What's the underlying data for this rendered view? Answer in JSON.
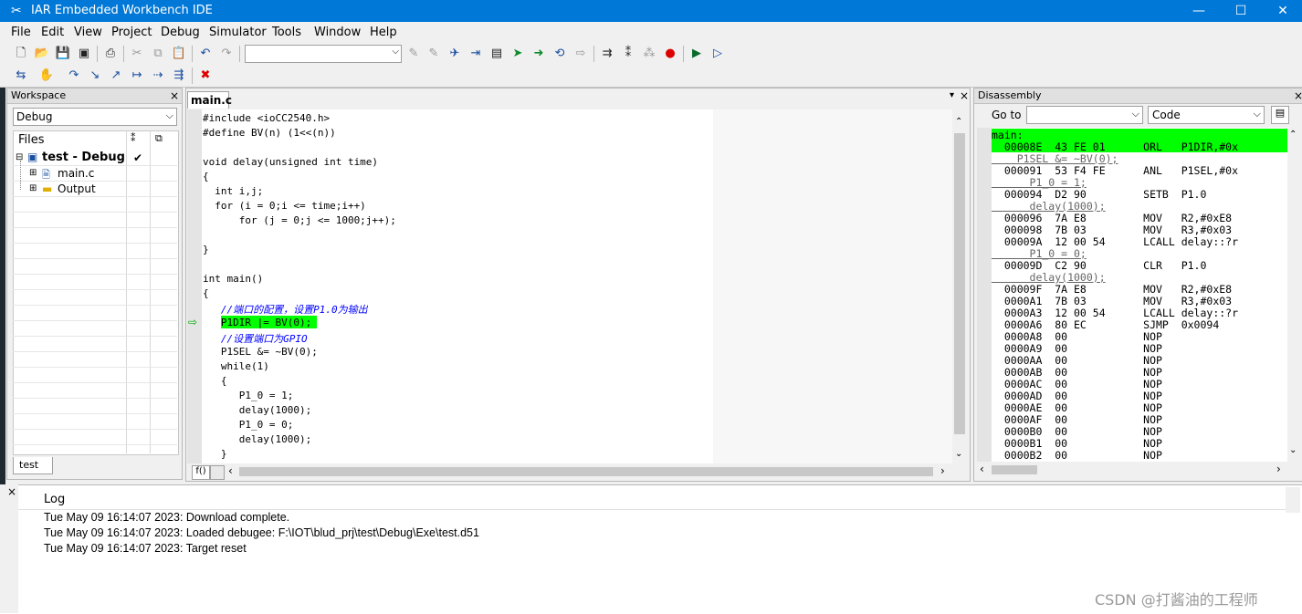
{
  "window": {
    "title": "IAR Embedded Workbench IDE"
  },
  "menu": [
    "File",
    "Edit",
    "View",
    "Project",
    "Debug",
    "Simulator",
    "Tools",
    "Window",
    "Help"
  ],
  "workspace": {
    "title": "Workspace",
    "config": "Debug",
    "files_header": "Files",
    "tree": [
      {
        "label": "test - Debug",
        "check": "✔"
      },
      {
        "label": "main.c"
      },
      {
        "label": "Output"
      }
    ],
    "bottom_tab": "test"
  },
  "editor": {
    "tab": "main.c",
    "status_left": "f()",
    "lines": [
      "#include <ioCC2540.h>",
      "#define BV(n) (1<<(n))",
      "",
      "void delay(unsigned int time)",
      "{",
      "  int i,j;",
      "  for (i = 0;i <= time;i++)",
      "      for (j = 0;j <= 1000;j++);",
      "",
      "}",
      "",
      "int main()",
      "{",
      "   //端口的配置，设置P1.0为输出",
      "   P1DIR |= BV(0);",
      "   //设置端口为GPIO",
      "   P1SEL &= ~BV(0);",
      "   while(1)",
      "   {",
      "      P1_0 = 1;",
      "      delay(1000);",
      "      P1_0 = 0;",
      "      delay(1000);",
      "   }"
    ],
    "current_line_index": 14
  },
  "disassembly": {
    "title": "Disassembly",
    "goto_label": "Go to",
    "goto_value": "",
    "mode": "Code",
    "lines": [
      {
        "text": "main:",
        "hl": true
      },
      {
        "text": "  00008E  43 FE 01      ORL   P1DIR,#0x",
        "hl": true
      },
      {
        "text": "    P1SEL &= ~BV(0);",
        "src": true
      },
      {
        "text": "  000091  53 F4 FE      ANL   P1SEL,#0x"
      },
      {
        "text": "      P1_0 = 1;",
        "src": true
      },
      {
        "text": "  000094  D2 90         SETB  P1.0"
      },
      {
        "text": "      delay(1000);",
        "src": true
      },
      {
        "text": "  000096  7A E8         MOV   R2,#0xE8"
      },
      {
        "text": "  000098  7B 03         MOV   R3,#0x03"
      },
      {
        "text": "  00009A  12 00 54      LCALL delay::?r"
      },
      {
        "text": "      P1_0 = 0;",
        "src": true
      },
      {
        "text": "  00009D  C2 90         CLR   P1.0"
      },
      {
        "text": "      delay(1000);",
        "src": true
      },
      {
        "text": "  00009F  7A E8         MOV   R2,#0xE8"
      },
      {
        "text": "  0000A1  7B 03         MOV   R3,#0x03"
      },
      {
        "text": "  0000A3  12 00 54      LCALL delay::?r"
      },
      {
        "text": "  0000A6  80 EC         SJMP  0x0094"
      },
      {
        "text": "  0000A8  00            NOP"
      },
      {
        "text": "  0000A9  00            NOP"
      },
      {
        "text": "  0000AA  00            NOP"
      },
      {
        "text": "  0000AB  00            NOP"
      },
      {
        "text": "  0000AC  00            NOP"
      },
      {
        "text": "  0000AD  00            NOP"
      },
      {
        "text": "  0000AE  00            NOP"
      },
      {
        "text": "  0000AF  00            NOP"
      },
      {
        "text": "  0000B0  00            NOP"
      },
      {
        "text": "  0000B1  00            NOP"
      },
      {
        "text": "  0000B2  00            NOP"
      }
    ]
  },
  "log": {
    "header": "Log",
    "entries": [
      "Tue May 09 16:14:07 2023: Download complete.",
      "Tue May 09 16:14:07 2023: Loaded debugee: F:\\IOT\\blud_prj\\test\\Debug\\Exe\\test.d51",
      "Tue May 09 16:14:07 2023: Target reset"
    ]
  },
  "watermark": "CSDN @打酱油的工程师",
  "colors": {
    "titlebar": "#0078d7",
    "highlight": "#00ff00"
  }
}
